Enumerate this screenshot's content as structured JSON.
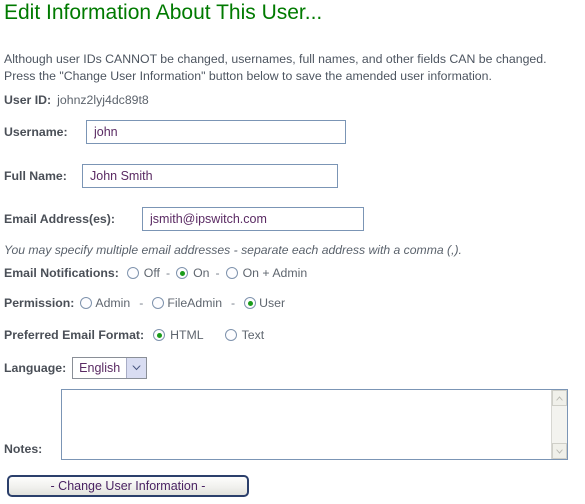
{
  "page": {
    "title": "Edit Information About This User...",
    "title_color": "#007a00",
    "intro_line1": "Although user IDs CANNOT be changed, usernames, full names, and other fields CAN be changed.",
    "intro_line2": "Press the \"Change User Information\" button below to save the amended user information."
  },
  "form": {
    "user_id": {
      "label": "User ID:",
      "value": "johnz2lyj4dc89t8"
    },
    "username": {
      "label": "Username:",
      "value": "john",
      "placeholder": ""
    },
    "full_name": {
      "label": "Full Name:",
      "value": "John Smith",
      "placeholder": ""
    },
    "email": {
      "label": "Email Address(es):",
      "value": "jsmith@ipswitch.com",
      "placeholder": ""
    },
    "email_hint": "You may specify multiple email addresses - separate each address with a comma (,).",
    "email_notifications": {
      "label": "Email Notifications:",
      "selected": "On",
      "options": [
        {
          "label": "Off",
          "selected": false
        },
        {
          "label": "On",
          "selected": true
        },
        {
          "label": "On + Admin",
          "selected": false
        }
      ],
      "separator": "-"
    },
    "permission": {
      "label": "Permission:",
      "selected": "User",
      "options": [
        {
          "label": "Admin",
          "selected": false
        },
        {
          "label": "FileAdmin",
          "selected": false
        },
        {
          "label": "User",
          "selected": true
        }
      ],
      "separator": "-"
    },
    "email_format": {
      "label": "Preferred Email Format:",
      "selected": "HTML",
      "options": [
        {
          "label": "HTML",
          "selected": true
        },
        {
          "label": "Text",
          "selected": false
        }
      ]
    },
    "language": {
      "label": "Language:",
      "value": "English",
      "options": [
        "English"
      ]
    },
    "notes": {
      "label": "Notes:",
      "value": "",
      "placeholder": ""
    }
  },
  "actions": {
    "submit_label": "- Change User Information -"
  },
  "colors": {
    "title_green": "#007a00",
    "label_gray": "#4a4f57",
    "input_text": "#5a2a63",
    "input_border": "#7b95b5",
    "radio_dot_green": "#1a9c1a",
    "button_border": "#2b3f6b"
  }
}
